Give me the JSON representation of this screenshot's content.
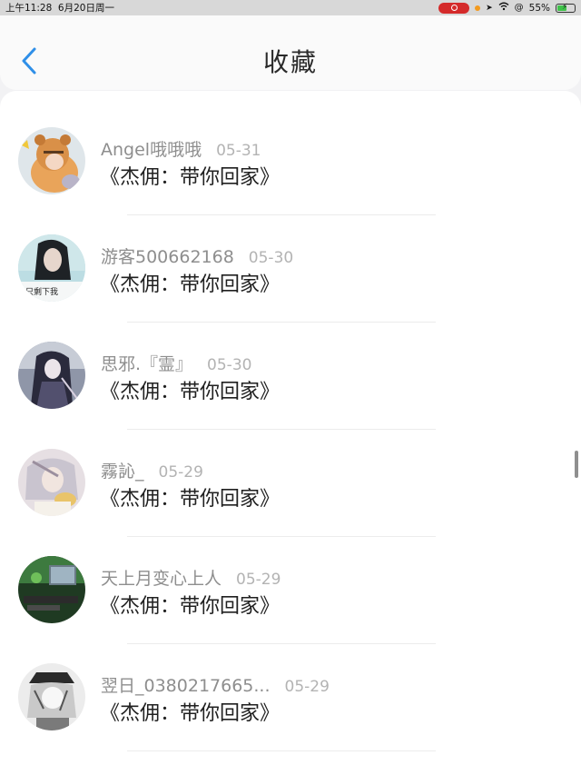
{
  "status_bar": {
    "time_date": "上午11:28  6月20日周一",
    "battery": "55%",
    "battery_level": 0.55,
    "colors": {
      "record": "#d42a2a",
      "battery_fill": "#3fc24a"
    }
  },
  "header": {
    "title": "收藏",
    "back_icon": "chevron-left-icon",
    "accent_color": "#2f8fe8"
  },
  "favorites": [
    {
      "user": "Angel哦哦哦",
      "date": "05-31",
      "title": "《杰佣：带你回家》",
      "avatar": "tiger-costume-avatar"
    },
    {
      "user": "游客500662168",
      "date": "05-30",
      "title": "《杰佣：带你回家》",
      "avatar": "girl-portrait-avatar",
      "avatar_caption": "只剩下我"
    },
    {
      "user": "思邪.『霊』",
      "date": "05-30",
      "title": "《杰佣：带你回家》",
      "avatar": "anime-dark-hair-avatar"
    },
    {
      "user": "霧訫_",
      "date": "05-29",
      "title": "《杰佣：带你回家》",
      "avatar": "anime-white-hair-avatar"
    },
    {
      "user": "天上月变心上人",
      "date": "05-29",
      "title": "《杰佣：带你回家》",
      "avatar": "desk-setup-avatar"
    },
    {
      "user": "翌日_0380217665...",
      "date": "05-29",
      "title": "《杰佣：带你回家》",
      "avatar": "manga-hat-avatar"
    }
  ]
}
